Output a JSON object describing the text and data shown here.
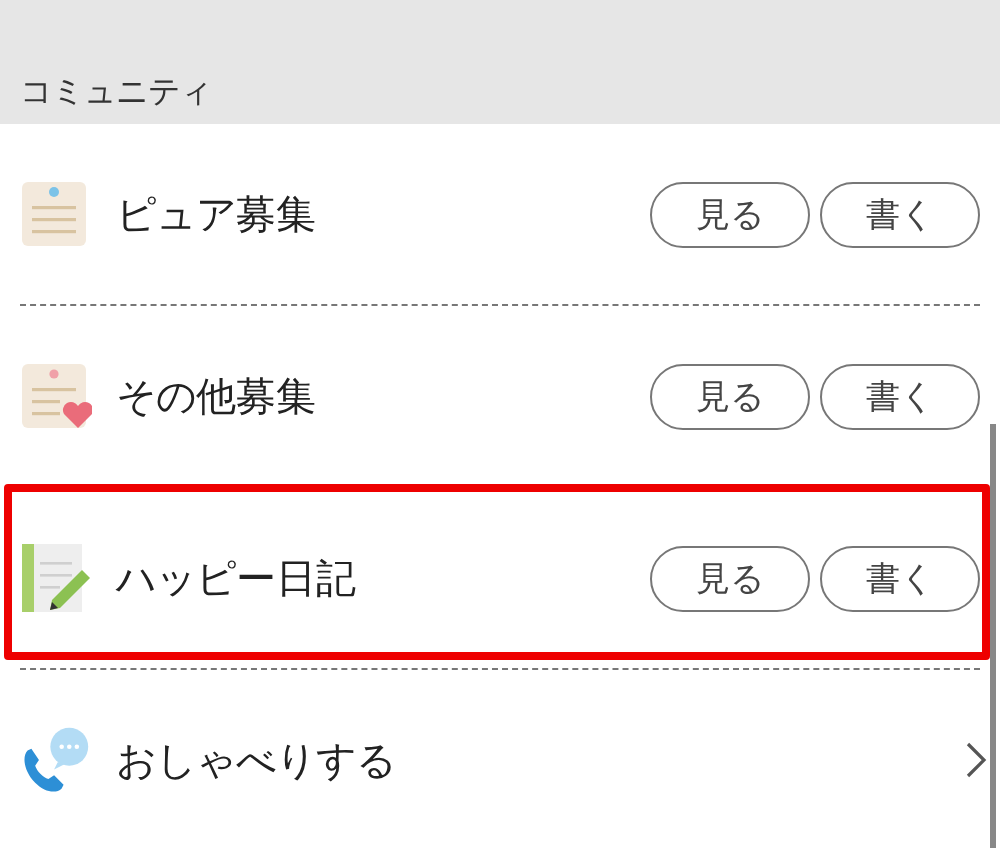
{
  "section": {
    "title": "コミュニティ"
  },
  "items": [
    {
      "label": "ピュア募集",
      "kind": "buttons",
      "buttons": [
        "見る",
        "書く"
      ],
      "highlighted": false
    },
    {
      "label": "その他募集",
      "kind": "buttons",
      "buttons": [
        "見る",
        "書く"
      ],
      "highlighted": false
    },
    {
      "label": "ハッピー日記",
      "kind": "buttons",
      "buttons": [
        "見る",
        "書く"
      ],
      "highlighted": true
    },
    {
      "label": "おしゃべりする",
      "kind": "link",
      "highlighted": false
    }
  ]
}
